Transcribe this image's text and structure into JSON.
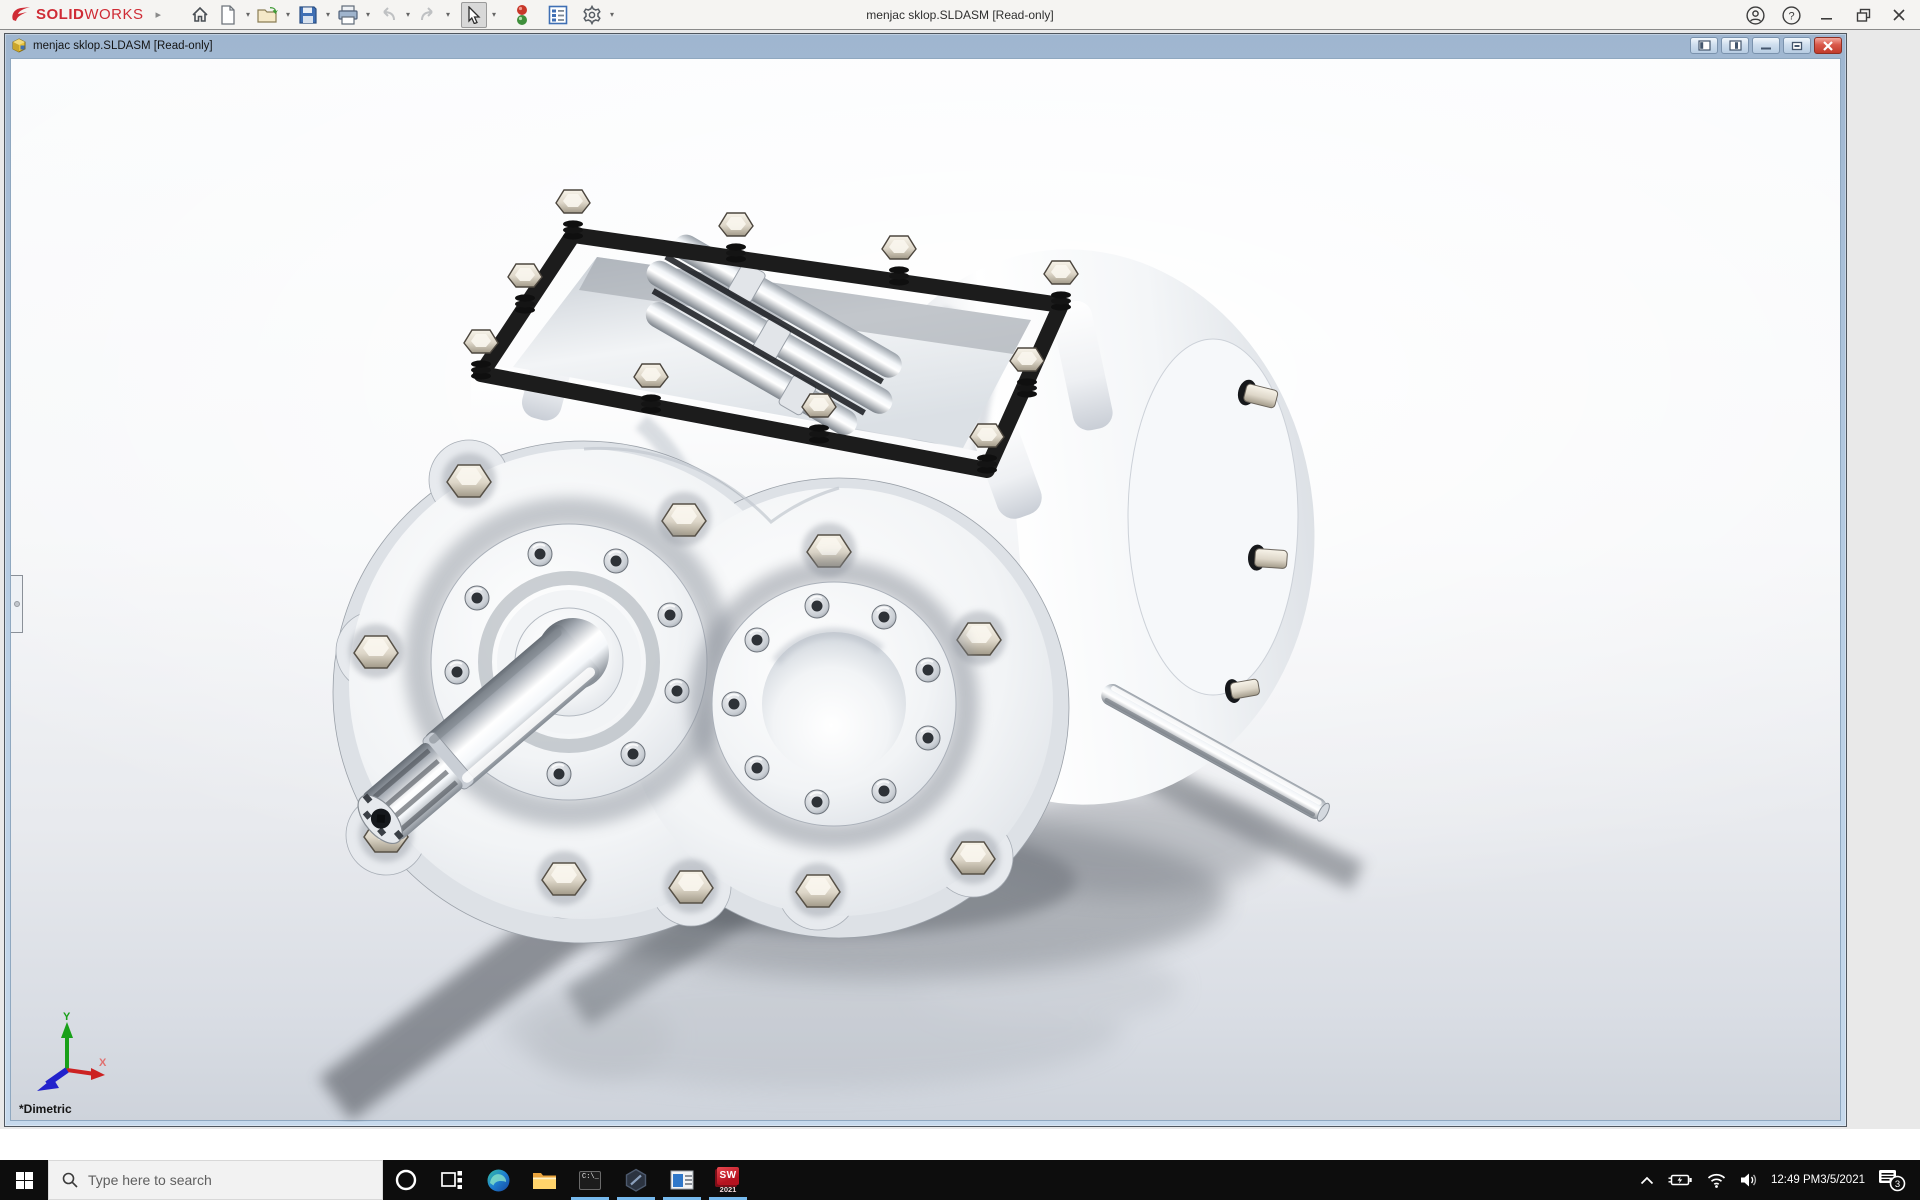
{
  "app": {
    "brand": {
      "solid": "SOLID",
      "works": "WORKS"
    },
    "window_title": "menjac sklop.SLDASM [Read-only]",
    "toolbar": {
      "items": [
        "home",
        "new",
        "open",
        "save",
        "print",
        "undo",
        "redo",
        "select",
        "resource-monitor",
        "options-list",
        "settings"
      ],
      "dropdown_glyph": "▾"
    }
  },
  "document_window": {
    "title": "menjac sklop.SLDASM [Read-only]",
    "view_orientation_label": "*Dimetric",
    "triad_labels": {
      "x": "X",
      "y": "Y"
    }
  },
  "taskbar": {
    "search_placeholder": "Type here to search",
    "apps": [
      "start",
      "search",
      "cortana",
      "task-view",
      "edge",
      "file-explorer",
      "command-prompt",
      "hex-app",
      "window-app",
      "solidworks-2021"
    ],
    "cmd_icon_text": "C:\\_",
    "solidworks_icon_text": "SW",
    "solidworks_badge_year": "2021",
    "running_indicator_color": "#76b9ed"
  },
  "tray": {
    "time": "12:49 PM",
    "date": "3/5/2021",
    "notification_count": "3"
  },
  "colors": {
    "taskbar_bg": "#0d0d0d",
    "app_titlebar_bg": "#f5f4f2",
    "doc_titlebar_top": "#9fb6d0",
    "doc_titlebar_bottom": "#c6d9ec",
    "mdi_bg": "#e9e9e9",
    "close_button_red": "#c03a2b",
    "brand_red": "#cf2b35"
  }
}
